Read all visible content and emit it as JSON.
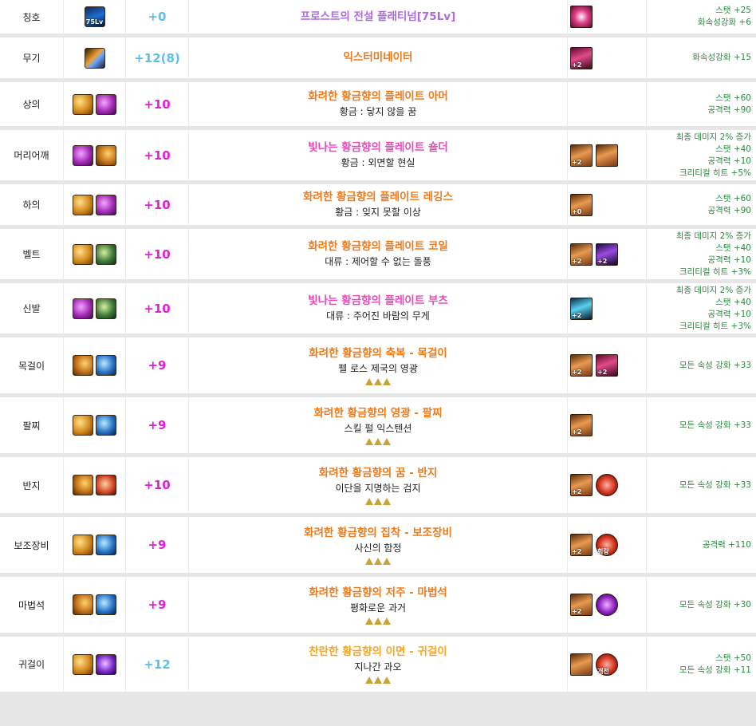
{
  "colors": {
    "plus_cyan": "#5bc0eb",
    "plus_magenta": "#e020d8",
    "name_orange": "#ef7a1a",
    "name_pink": "#ea4ab8",
    "name_purple": "#b06ae0",
    "name_gold": "#f5a623",
    "stat_green": "#2b8a3e"
  },
  "rows": [
    {
      "slot": "칭호",
      "icons": [
        "title-gem-icon"
      ],
      "plus": "+0",
      "plus_color": "cyan",
      "name": "프로스트의 전설 플래티넘[75Lv]",
      "name_color": "purple",
      "set": "",
      "tri": 0,
      "title_icon_text": "75Lv",
      "emblems": [
        {
          "kind": "title-emblem",
          "label": ""
        }
      ],
      "stats": [
        "스탯 +25",
        "화속성강화 +6"
      ]
    },
    {
      "slot": "무기",
      "icons": [
        "sword-icon"
      ],
      "plus": "+12(8)",
      "plus_color": "cyan",
      "name": "익스터미네이터",
      "name_color": "orange",
      "set": "",
      "tri": 0,
      "emblems": [
        {
          "kind": "pink",
          "label": "+2"
        }
      ],
      "stats": [
        "화속성강화 +15"
      ]
    },
    {
      "slot": "상의",
      "icons": [
        "gold-armor-icon",
        "purple-armor-icon"
      ],
      "plus": "+10",
      "plus_color": "magenta",
      "name": "화려한 황금향의 플레이트 아머",
      "name_color": "orange",
      "set": "황금 : 닿지 않을 꿈",
      "tri": 0,
      "emblems": [],
      "stats": [
        "스탯 +60",
        "공격력 +90"
      ]
    },
    {
      "slot": "머리어깨",
      "icons": [
        "purple-shoulder-icon",
        "gold-shoulder-icon"
      ],
      "plus": "+10",
      "plus_color": "magenta",
      "name": "빛나는 황금향의 플레이트 숄더",
      "name_color": "pink",
      "set": "황금 : 외면할 현실",
      "tri": 0,
      "emblems": [
        {
          "kind": "gold",
          "label": "+2"
        },
        {
          "kind": "gold",
          "label": ""
        }
      ],
      "stats": [
        "최종 데미지 2% 증가",
        "스탯 +40",
        "공격력 +10",
        "크리티컬 히트 +5%"
      ]
    },
    {
      "slot": "하의",
      "icons": [
        "gold-legs-icon",
        "purple-legs-icon"
      ],
      "plus": "+10",
      "plus_color": "magenta",
      "name": "화려한 황금향의 플레이트 레깅스",
      "name_color": "orange",
      "set": "황금 : 잊지 못할 이상",
      "tri": 0,
      "emblems": [
        {
          "kind": "gold",
          "label": "+0"
        }
      ],
      "stats": [
        "스탯 +60",
        "공격력 +90"
      ]
    },
    {
      "slot": "벨트",
      "icons": [
        "gold-belt-icon",
        "green-belt-icon"
      ],
      "plus": "+10",
      "plus_color": "magenta",
      "name": "화려한 황금향의 플레이트 코일",
      "name_color": "orange",
      "set": "대류 : 제어할 수 없는 돌풍",
      "tri": 0,
      "emblems": [
        {
          "kind": "gold",
          "label": "+2"
        },
        {
          "kind": "violet",
          "label": "+2"
        }
      ],
      "stats": [
        "최종 데미지 2% 증가",
        "스탯 +40",
        "공격력 +10",
        "크리티컬 히트 +3%"
      ]
    },
    {
      "slot": "신발",
      "icons": [
        "purple-boots-icon",
        "green-boots-icon"
      ],
      "plus": "+10",
      "plus_color": "magenta",
      "name": "빛나는 황금향의 플레이트 부츠",
      "name_color": "pink",
      "set": "대류 : 주어진 바람의 무게",
      "tri": 0,
      "emblems": [
        {
          "kind": "blue",
          "label": "+2"
        }
      ],
      "stats": [
        "최종 데미지 2% 증가",
        "스탯 +40",
        "공격력 +10",
        "크리티컬 히트 +3%"
      ]
    },
    {
      "slot": "목걸이",
      "icons": [
        "gold-necklace-icon",
        "blue-necklace-icon"
      ],
      "plus": "+9",
      "plus_color": "magenta",
      "name": "화려한 황금향의 축복 - 목걸이",
      "name_color": "orange",
      "set": "펠 로스 제국의 영광",
      "tri": 3,
      "emblems": [
        {
          "kind": "gold",
          "label": "+2"
        },
        {
          "kind": "pink",
          "label": "+2"
        }
      ],
      "stats": [
        "모든 속성 강화 +33"
      ]
    },
    {
      "slot": "팔찌",
      "icons": [
        "gold-bracelet-icon",
        "blue-bracelet-icon"
      ],
      "plus": "+9",
      "plus_color": "magenta",
      "name": "화려한 황금향의 영광 - 팔찌",
      "name_color": "orange",
      "set": "스킬 펄 익스텐션",
      "tri": 3,
      "emblems": [
        {
          "kind": "gold",
          "label": "+2"
        }
      ],
      "stats": [
        "모든 속성 강화 +33"
      ]
    },
    {
      "slot": "반지",
      "icons": [
        "gold-ring-icon",
        "red-ring-icon"
      ],
      "plus": "+10",
      "plus_color": "magenta",
      "name": "화려한 황금향의 꿈 - 반지",
      "name_color": "orange",
      "set": "이단을 지명하는 검지",
      "tri": 3,
      "emblems": [
        {
          "kind": "gold",
          "label": "+2"
        },
        {
          "kind": "round",
          "label": ""
        }
      ],
      "stats": [
        "모든 속성 강화 +33"
      ]
    },
    {
      "slot": "보조장비",
      "icons": [
        "gold-sub-icon",
        "blue-sub-icon"
      ],
      "plus": "+9",
      "plus_color": "magenta",
      "name": "화려한 황금향의 집착 - 보조장비",
      "name_color": "orange",
      "set": "사신의 함정",
      "tri": 3,
      "emblems": [
        {
          "kind": "gold",
          "label": "+2"
        },
        {
          "kind": "round",
          "label": "회랑"
        }
      ],
      "stats": [
        "공격력 +110"
      ]
    },
    {
      "slot": "마법석",
      "icons": [
        "gold-magicstone-icon",
        "blue-magicstone-icon"
      ],
      "plus": "+9",
      "plus_color": "magenta",
      "name": "화려한 황금향의 저주 - 마법석",
      "name_color": "orange",
      "set": "평화로운 과거",
      "tri": 3,
      "emblems": [
        {
          "kind": "gold",
          "label": "+2"
        },
        {
          "kind": "roundv",
          "label": ""
        }
      ],
      "stats": [
        "모든 속성 강화 +30"
      ]
    },
    {
      "slot": "귀걸이",
      "icons": [
        "gold-earring-icon",
        "violet-earring-icon"
      ],
      "plus": "+12",
      "plus_color": "cyan",
      "name": "찬란한 황금향의 이면 - 귀걸이",
      "name_color": "gold",
      "set": "지나간 과오",
      "tri": 3,
      "emblems": [
        {
          "kind": "gold",
          "label": ""
        },
        {
          "kind": "round",
          "label": "개전"
        }
      ],
      "stats": [
        "스탯 +50",
        "모든 속성 강화 +11"
      ]
    }
  ]
}
